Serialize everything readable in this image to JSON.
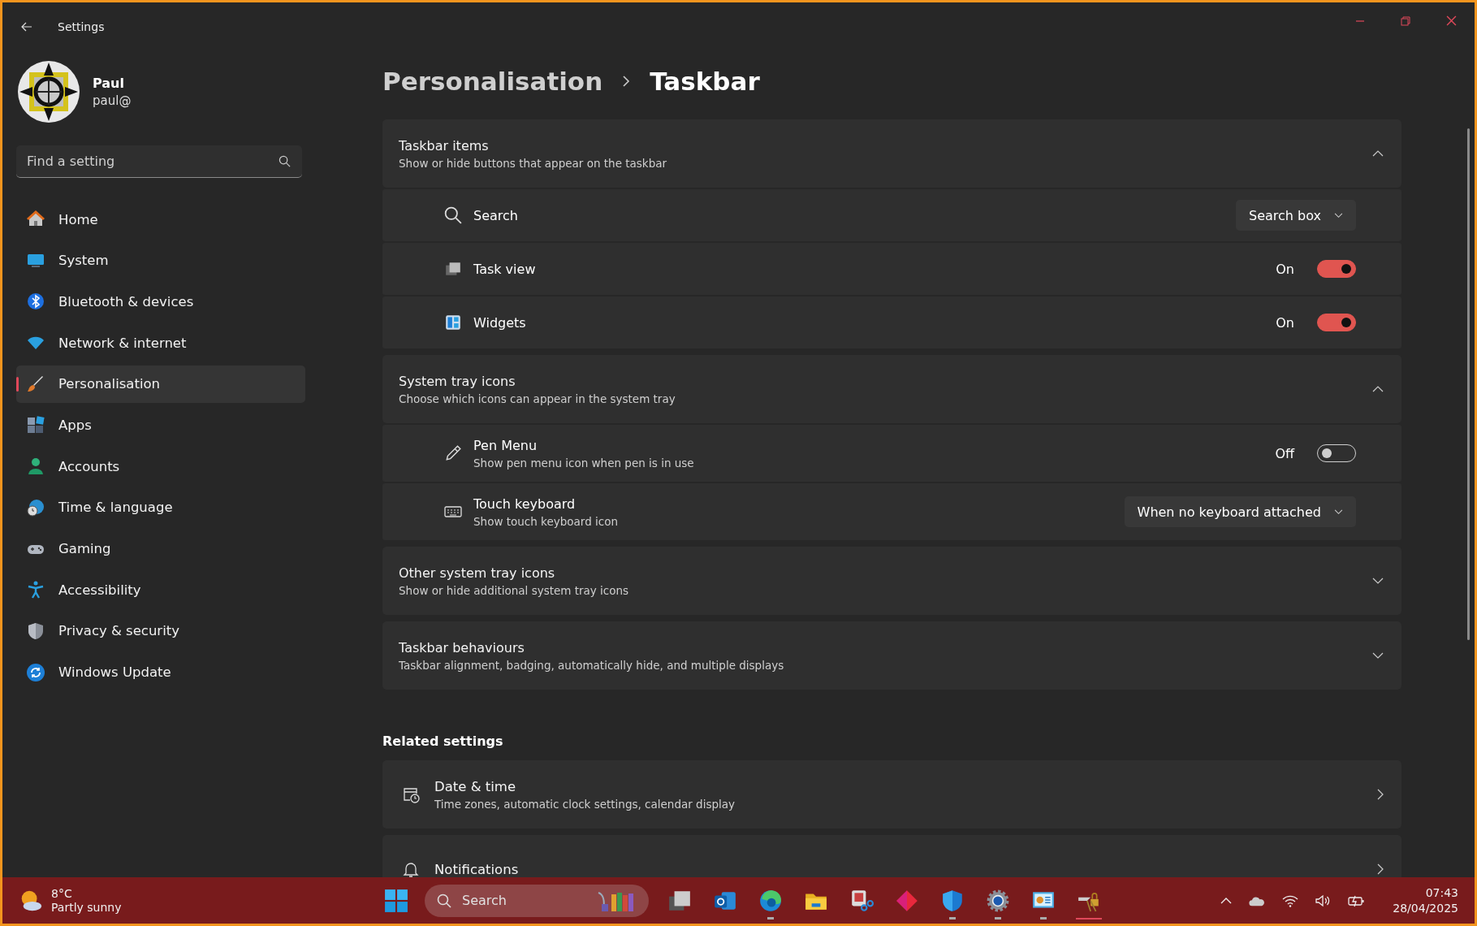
{
  "window": {
    "title": "Settings"
  },
  "user": {
    "name": "Paul",
    "email": "paul@"
  },
  "search": {
    "placeholder": "Find a setting"
  },
  "nav": [
    {
      "label": "Home",
      "selected": false
    },
    {
      "label": "System",
      "selected": false
    },
    {
      "label": "Bluetooth & devices",
      "selected": false
    },
    {
      "label": "Network & internet",
      "selected": false
    },
    {
      "label": "Personalisation",
      "selected": true
    },
    {
      "label": "Apps",
      "selected": false
    },
    {
      "label": "Accounts",
      "selected": false
    },
    {
      "label": "Time & language",
      "selected": false
    },
    {
      "label": "Gaming",
      "selected": false
    },
    {
      "label": "Accessibility",
      "selected": false
    },
    {
      "label": "Privacy & security",
      "selected": false
    },
    {
      "label": "Windows Update",
      "selected": false
    }
  ],
  "breadcrumb": [
    "Personalisation",
    "Taskbar"
  ],
  "sections": [
    {
      "title": "Taskbar items",
      "subtitle": "Show or hide buttons that appear on the taskbar",
      "expanded": true,
      "items": [
        {
          "kind": "dropdown",
          "label": "Search",
          "value": "Search box"
        },
        {
          "kind": "toggle",
          "label": "Task view",
          "state_label": "On",
          "on": true
        },
        {
          "kind": "toggle",
          "label": "Widgets",
          "state_label": "On",
          "on": true
        }
      ]
    },
    {
      "title": "System tray icons",
      "subtitle": "Choose which icons can appear in the system tray",
      "expanded": true,
      "items": [
        {
          "kind": "toggle",
          "label": "Pen Menu",
          "description": "Show pen menu icon when pen is in use",
          "state_label": "Off",
          "on": false
        },
        {
          "kind": "dropdown",
          "label": "Touch keyboard",
          "description": "Show touch keyboard icon",
          "value": "When no keyboard attached"
        }
      ]
    },
    {
      "title": "Other system tray icons",
      "subtitle": "Show or hide additional system tray icons",
      "expanded": false
    },
    {
      "title": "Taskbar behaviours",
      "subtitle": "Taskbar alignment, badging, automatically hide, and multiple displays",
      "expanded": false
    }
  ],
  "related": {
    "heading": "Related settings",
    "items": [
      {
        "title": "Date & time",
        "subtitle": "Time zones, automatic clock settings, calendar display"
      },
      {
        "title": "Notifications"
      }
    ]
  },
  "taskbar": {
    "weather": {
      "temp": "8°C",
      "condition": "Partly sunny"
    },
    "search": {
      "placeholder": "Search"
    },
    "apps": [
      {
        "running": false,
        "focused": false
      },
      {
        "running": false,
        "focused": false
      },
      {
        "running": true,
        "focused": false
      },
      {
        "running": false,
        "focused": false
      },
      {
        "running": false,
        "focused": false
      },
      {
        "running": false,
        "focused": false
      },
      {
        "running": true,
        "focused": false
      },
      {
        "running": true,
        "focused": false
      },
      {
        "running": true,
        "focused": false
      },
      {
        "running": false,
        "focused": true
      }
    ],
    "clock": {
      "time": "07:43",
      "date": "28/04/2025"
    }
  }
}
